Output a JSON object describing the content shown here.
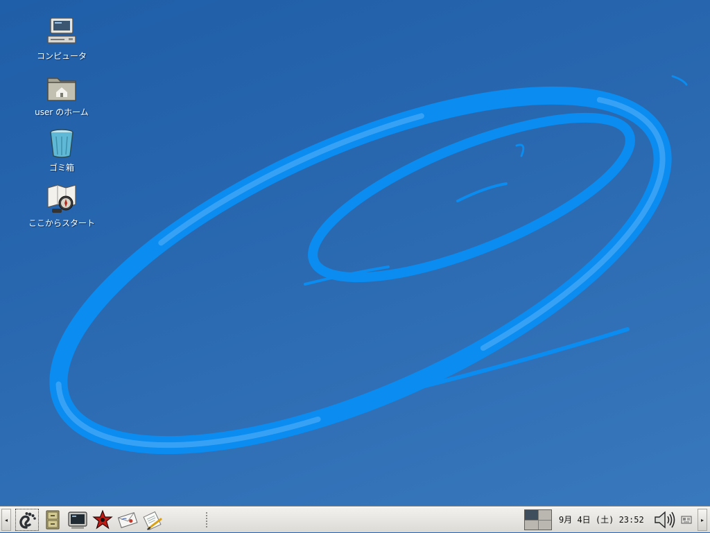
{
  "desktop": {
    "icons": [
      {
        "label": "コンピュータ",
        "icon": "computer-icon"
      },
      {
        "label": "user のホーム",
        "icon": "home-folder-icon"
      },
      {
        "label": "ゴミ箱",
        "icon": "trash-icon"
      },
      {
        "label": "ここからスタート",
        "icon": "start-here-icon"
      }
    ],
    "colors": {
      "background": "#2a69b0",
      "swirl": "#0a8cf0"
    }
  },
  "panel": {
    "hide_left": "◂",
    "hide_right": "▸",
    "launchers": [
      {
        "icon": "gnome-foot-menu-icon"
      },
      {
        "icon": "file-cabinet-icon"
      },
      {
        "icon": "terminal-icon"
      },
      {
        "icon": "red-star-icon"
      },
      {
        "icon": "mail-icon"
      },
      {
        "icon": "text-editor-icon"
      }
    ],
    "workspaces": {
      "count": 4,
      "active": 1
    },
    "clock": "9月 4日 (土) 23:52",
    "tray": [
      {
        "icon": "volume-icon"
      },
      {
        "icon": "keyboard-indicator-icon"
      }
    ]
  }
}
